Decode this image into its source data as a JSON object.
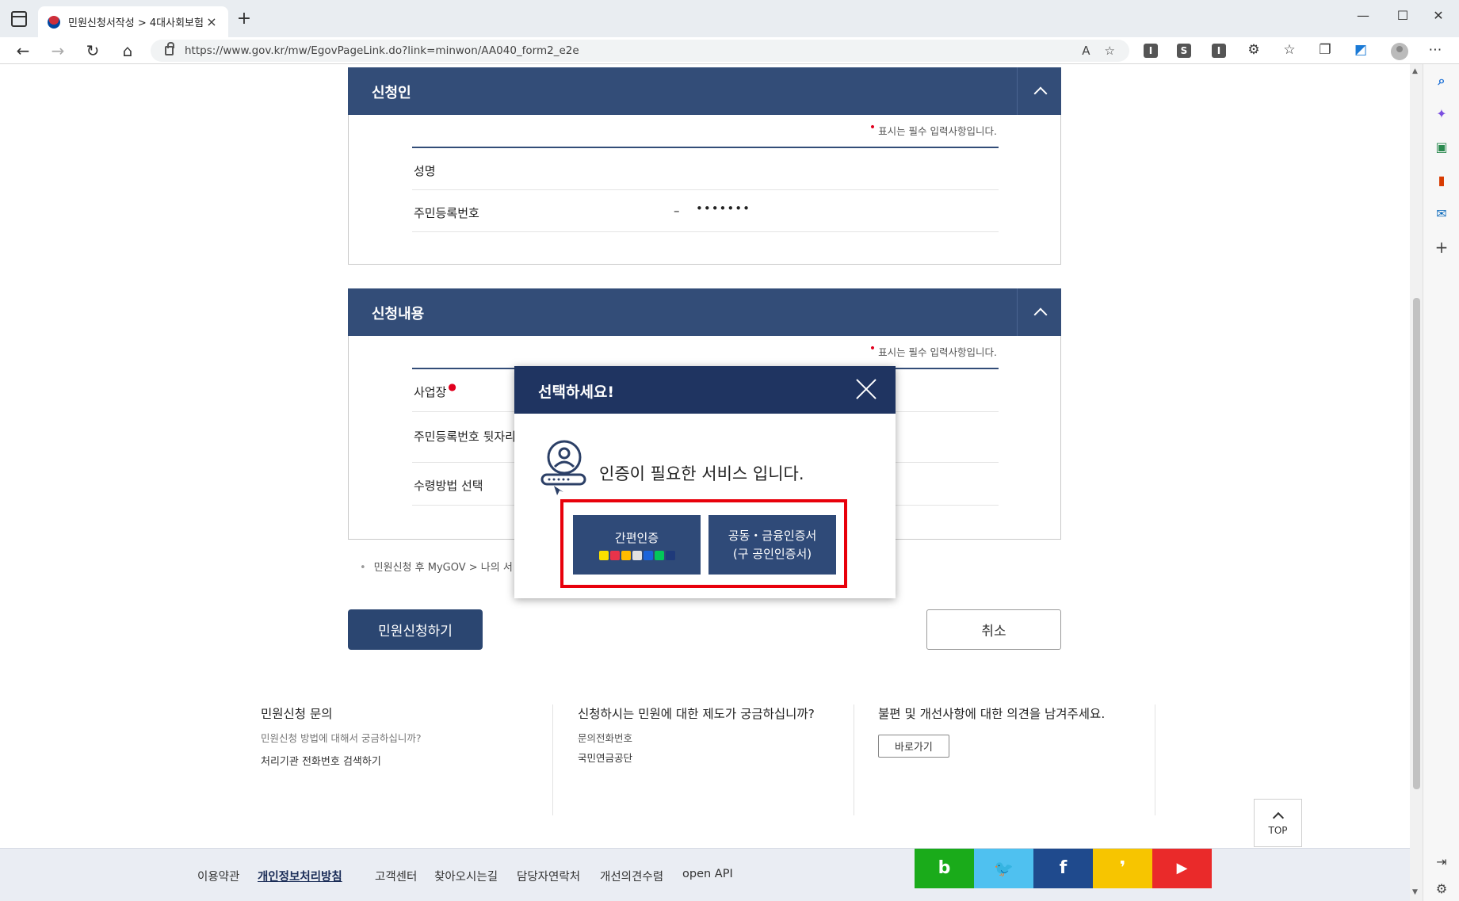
{
  "browser": {
    "tab_title": "민원신청서작성 > 4대사회보험",
    "tab_close": "×",
    "new_tab": "+",
    "url": "https://www.gov.kr/mw/EgovPageLink.do?link=minwon/AA040_form2_e2e",
    "extensions": [
      "I",
      "S",
      "I"
    ],
    "window_controls": [
      "—",
      "☐",
      "✕"
    ]
  },
  "applicant_panel": {
    "title": "신청인",
    "required_note": "표시는 필수 입력사항입니다.",
    "fields": [
      {
        "label": "성명"
      },
      {
        "label": "주민등록번호",
        "dash": "–",
        "masked": "•••••••"
      }
    ]
  },
  "content_panel": {
    "title": "신청내용",
    "required_note": "표시는 필수 입력사항입니다.",
    "fields": [
      {
        "label": "사업장"
      },
      {
        "label": "주민등록번호 뒷자리"
      },
      {
        "label": "수령방법 선택"
      }
    ]
  },
  "after_note": "민원신청 후 MyGOV > 나의 서",
  "actions": {
    "submit": "민원신청하기",
    "cancel": "취소"
  },
  "help": {
    "col1": {
      "title": "민원신청 문의",
      "sub": "민원신청 방법에 대해서 궁금하십니까?",
      "link": "처리기관 전화번호 검색하기"
    },
    "col2": {
      "title": "신청하시는 민원에 대한 제도가 궁금하십니까?",
      "line1": "문의전화번호",
      "line2": "국민연금공단"
    },
    "col3": {
      "title": "불편 및 개선사항에 대한 의견을 남겨주세요.",
      "button": "바로가기"
    }
  },
  "top_button": "TOP",
  "footer": {
    "links": [
      "이용약관",
      "개인정보처리방침",
      "고객센터",
      "찾아오시는길",
      "담당자연락처",
      "개선의견수렴",
      "open API"
    ],
    "social": [
      {
        "name": "blog",
        "glyph": "b",
        "color": "#1aab1a"
      },
      {
        "name": "twitter",
        "glyph": "🐦",
        "color": "#4fc1f0"
      },
      {
        "name": "facebook",
        "glyph": "f",
        "color": "#1f4a8d"
      },
      {
        "name": "kakaostory",
        "glyph": "❜",
        "color": "#f7c500"
      },
      {
        "name": "youtube",
        "glyph": "▶",
        "color": "#ea2a2a"
      }
    ]
  },
  "dialog": {
    "title": "선택하세요!",
    "message": "인증이 필요한 서비스 입니다.",
    "simple_auth": "간편인증",
    "cert_auth_line1": "공동・금융인증서",
    "cert_auth_line2": "(구 공인인증서)",
    "providers": [
      {
        "name": "kakao",
        "color": "#fae100"
      },
      {
        "name": "pass",
        "color": "#e8334a"
      },
      {
        "name": "kb",
        "color": "#ffbc00"
      },
      {
        "name": "samsung",
        "color": "#e2e2e2"
      },
      {
        "name": "toss",
        "color": "#1b64da"
      },
      {
        "name": "naver",
        "color": "#03c75a"
      },
      {
        "name": "bank",
        "color": "#1f3a7a"
      }
    ]
  }
}
